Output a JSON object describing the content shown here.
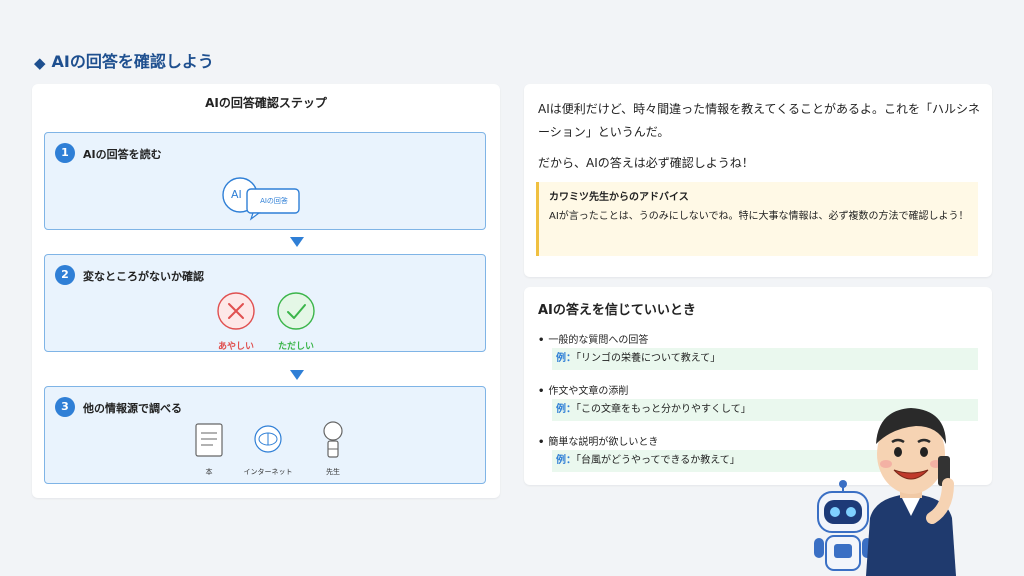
{
  "page_title": "AIの回答を確認しよう",
  "left_panel": {
    "title": "AIの回答確認ステップ",
    "steps": [
      {
        "number": "1",
        "label": "AIの回答を読む",
        "bubble_ai": "AI",
        "bubble_text": "AIの回答"
      },
      {
        "number": "2",
        "label": "変なところがないか確認",
        "judge_bad": "あやしい",
        "judge_good": "ただしい"
      },
      {
        "number": "3",
        "label": "他の情報源で調べる",
        "sources": [
          "本",
          "インターネット",
          "先生"
        ]
      }
    ]
  },
  "intro": {
    "paragraph1": "AIは便利だけど、時々間違った情報を教えてくることがあるよ。これを「ハルシネーション」というんだ。",
    "paragraph2": "だから、AIの答えは必ず確認しようね！",
    "advice_title": "カワミツ先生からのアドバイス",
    "advice_text": "AIが言ったことは、うのみにしないでね。特に大事な情報は、必ず複数の方法で確認しよう！"
  },
  "trust": {
    "title": "AIの答えを信じていいとき",
    "example_prefix": "例：",
    "items": [
      {
        "label": "一般的な質問への回答",
        "example": "「リンゴの栄養について教えて」"
      },
      {
        "label": "作文や文章の添削",
        "example": "「この文章をもっと分かりやすくして」"
      },
      {
        "label": "簡単な説明が欲しいとき",
        "example": "「台風がどうやってできるか教えて」"
      }
    ]
  },
  "colors": {
    "accent_blue": "#2f7fd6",
    "title_blue": "#1e4f8f",
    "bad_red": "#e05050",
    "good_green": "#3bb54a",
    "advice_yellow": "#f0c040"
  }
}
